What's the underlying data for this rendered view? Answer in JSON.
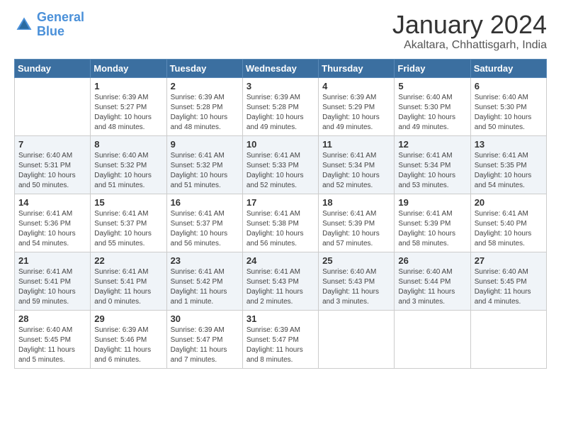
{
  "header": {
    "logo_line1": "General",
    "logo_line2": "Blue",
    "month": "January 2024",
    "location": "Akaltara, Chhattisgarh, India"
  },
  "days_of_week": [
    "Sunday",
    "Monday",
    "Tuesday",
    "Wednesday",
    "Thursday",
    "Friday",
    "Saturday"
  ],
  "weeks": [
    [
      {
        "day": "",
        "info": ""
      },
      {
        "day": "1",
        "info": "Sunrise: 6:39 AM\nSunset: 5:27 PM\nDaylight: 10 hours\nand 48 minutes."
      },
      {
        "day": "2",
        "info": "Sunrise: 6:39 AM\nSunset: 5:28 PM\nDaylight: 10 hours\nand 48 minutes."
      },
      {
        "day": "3",
        "info": "Sunrise: 6:39 AM\nSunset: 5:28 PM\nDaylight: 10 hours\nand 49 minutes."
      },
      {
        "day": "4",
        "info": "Sunrise: 6:39 AM\nSunset: 5:29 PM\nDaylight: 10 hours\nand 49 minutes."
      },
      {
        "day": "5",
        "info": "Sunrise: 6:40 AM\nSunset: 5:30 PM\nDaylight: 10 hours\nand 49 minutes."
      },
      {
        "day": "6",
        "info": "Sunrise: 6:40 AM\nSunset: 5:30 PM\nDaylight: 10 hours\nand 50 minutes."
      }
    ],
    [
      {
        "day": "7",
        "info": "Sunrise: 6:40 AM\nSunset: 5:31 PM\nDaylight: 10 hours\nand 50 minutes."
      },
      {
        "day": "8",
        "info": "Sunrise: 6:40 AM\nSunset: 5:32 PM\nDaylight: 10 hours\nand 51 minutes."
      },
      {
        "day": "9",
        "info": "Sunrise: 6:41 AM\nSunset: 5:32 PM\nDaylight: 10 hours\nand 51 minutes."
      },
      {
        "day": "10",
        "info": "Sunrise: 6:41 AM\nSunset: 5:33 PM\nDaylight: 10 hours\nand 52 minutes."
      },
      {
        "day": "11",
        "info": "Sunrise: 6:41 AM\nSunset: 5:34 PM\nDaylight: 10 hours\nand 52 minutes."
      },
      {
        "day": "12",
        "info": "Sunrise: 6:41 AM\nSunset: 5:34 PM\nDaylight: 10 hours\nand 53 minutes."
      },
      {
        "day": "13",
        "info": "Sunrise: 6:41 AM\nSunset: 5:35 PM\nDaylight: 10 hours\nand 54 minutes."
      }
    ],
    [
      {
        "day": "14",
        "info": "Sunrise: 6:41 AM\nSunset: 5:36 PM\nDaylight: 10 hours\nand 54 minutes."
      },
      {
        "day": "15",
        "info": "Sunrise: 6:41 AM\nSunset: 5:37 PM\nDaylight: 10 hours\nand 55 minutes."
      },
      {
        "day": "16",
        "info": "Sunrise: 6:41 AM\nSunset: 5:37 PM\nDaylight: 10 hours\nand 56 minutes."
      },
      {
        "day": "17",
        "info": "Sunrise: 6:41 AM\nSunset: 5:38 PM\nDaylight: 10 hours\nand 56 minutes."
      },
      {
        "day": "18",
        "info": "Sunrise: 6:41 AM\nSunset: 5:39 PM\nDaylight: 10 hours\nand 57 minutes."
      },
      {
        "day": "19",
        "info": "Sunrise: 6:41 AM\nSunset: 5:39 PM\nDaylight: 10 hours\nand 58 minutes."
      },
      {
        "day": "20",
        "info": "Sunrise: 6:41 AM\nSunset: 5:40 PM\nDaylight: 10 hours\nand 58 minutes."
      }
    ],
    [
      {
        "day": "21",
        "info": "Sunrise: 6:41 AM\nSunset: 5:41 PM\nDaylight: 10 hours\nand 59 minutes."
      },
      {
        "day": "22",
        "info": "Sunrise: 6:41 AM\nSunset: 5:41 PM\nDaylight: 11 hours\nand 0 minutes."
      },
      {
        "day": "23",
        "info": "Sunrise: 6:41 AM\nSunset: 5:42 PM\nDaylight: 11 hours\nand 1 minute."
      },
      {
        "day": "24",
        "info": "Sunrise: 6:41 AM\nSunset: 5:43 PM\nDaylight: 11 hours\nand 2 minutes."
      },
      {
        "day": "25",
        "info": "Sunrise: 6:40 AM\nSunset: 5:43 PM\nDaylight: 11 hours\nand 3 minutes."
      },
      {
        "day": "26",
        "info": "Sunrise: 6:40 AM\nSunset: 5:44 PM\nDaylight: 11 hours\nand 3 minutes."
      },
      {
        "day": "27",
        "info": "Sunrise: 6:40 AM\nSunset: 5:45 PM\nDaylight: 11 hours\nand 4 minutes."
      }
    ],
    [
      {
        "day": "28",
        "info": "Sunrise: 6:40 AM\nSunset: 5:45 PM\nDaylight: 11 hours\nand 5 minutes."
      },
      {
        "day": "29",
        "info": "Sunrise: 6:39 AM\nSunset: 5:46 PM\nDaylight: 11 hours\nand 6 minutes."
      },
      {
        "day": "30",
        "info": "Sunrise: 6:39 AM\nSunset: 5:47 PM\nDaylight: 11 hours\nand 7 minutes."
      },
      {
        "day": "31",
        "info": "Sunrise: 6:39 AM\nSunset: 5:47 PM\nDaylight: 11 hours\nand 8 minutes."
      },
      {
        "day": "",
        "info": ""
      },
      {
        "day": "",
        "info": ""
      },
      {
        "day": "",
        "info": ""
      }
    ]
  ]
}
